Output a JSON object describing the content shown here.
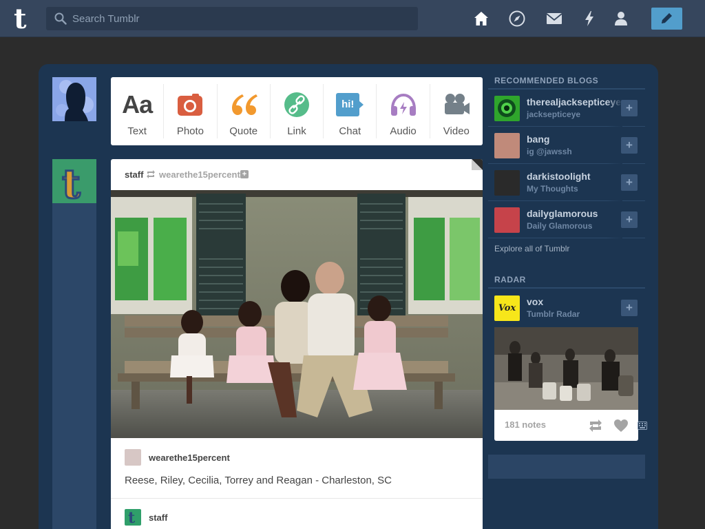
{
  "header": {
    "logo_letter": "t",
    "search_placeholder": "Search Tumblr",
    "nav_icons": [
      "home-icon",
      "explore-icon",
      "inbox-icon",
      "activity-icon",
      "account-icon"
    ],
    "compose_icon": "pencil-icon"
  },
  "post_types": [
    {
      "label": "Text",
      "glyph": "Aa",
      "color": "#444444"
    },
    {
      "label": "Photo",
      "glyph": "",
      "color": "#d95e40"
    },
    {
      "label": "Quote",
      "glyph": "“",
      "color": "#f2992e"
    },
    {
      "label": "Link",
      "glyph": "",
      "color": "#56bc8a"
    },
    {
      "label": "Chat",
      "glyph": "hi!",
      "color": "#529ecc"
    },
    {
      "label": "Audio",
      "glyph": "",
      "color": "#a77dc2"
    },
    {
      "label": "Video",
      "glyph": "",
      "color": "#748089"
    }
  ],
  "post": {
    "author": "staff",
    "reblogged_from": "wearethe15percent",
    "source_blog": "wearethe15percent",
    "caption": "Reese, Riley, Cecilia, Torrey and Reagan - Charleston, SC",
    "next_blog": "staff"
  },
  "sidebar": {
    "recommended_title": "RECOMMENDED BLOGS",
    "blogs": [
      {
        "name": "therealjacksepticeye",
        "title": "jacksepticeye",
        "avatar_color": "#2fa52c"
      },
      {
        "name": "bang",
        "title": "ig @jawssh",
        "avatar_color": "#c08a7a"
      },
      {
        "name": "darkistoolight",
        "title": "My Thoughts",
        "avatar_color": "#2a2a2a"
      },
      {
        "name": "dailyglamorous",
        "title": "Daily Glamorous",
        "avatar_color": "#c6434a"
      }
    ],
    "explore_label": "Explore all of Tumblr",
    "radar_title": "RADAR",
    "radar": {
      "name": "vox",
      "title": "Tumblr Radar",
      "notes": "181 notes",
      "badge": "Vox"
    }
  },
  "colors": {
    "topbar": "#36465d",
    "container": "#1c3551",
    "compose": "#529ecc"
  }
}
